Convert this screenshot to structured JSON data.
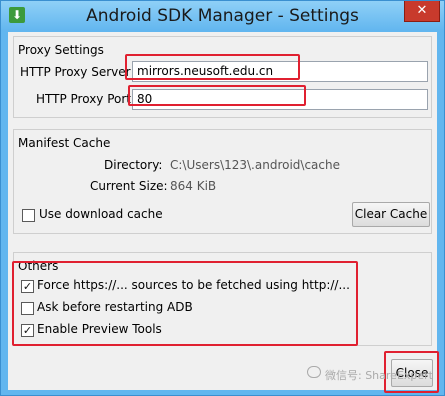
{
  "window": {
    "title": "Android SDK Manager - Settings",
    "app_icon": "download-arrow-icon",
    "close_glyph": "✕"
  },
  "proxy": {
    "group_title": "Proxy Settings",
    "server_label": "HTTP Proxy Server",
    "server_value": "mirrors.neusoft.edu.cn",
    "port_label": "HTTP Proxy Port",
    "port_value": "80"
  },
  "manifest": {
    "group_title": "Manifest Cache",
    "directory_label": "Directory:",
    "directory_value": "C:\\Users\\123\\.android\\cache",
    "size_label": "Current Size:",
    "size_value": "864 KiB",
    "use_cache_label": "Use download cache",
    "use_cache_checked": false,
    "clear_cache_label": "Clear Cache"
  },
  "others": {
    "group_title": "Others",
    "options": [
      {
        "label": "Force https://... sources to be fetched using http://...",
        "checked": true
      },
      {
        "label": "Ask before restarting ADB",
        "checked": false
      },
      {
        "label": "Enable Preview Tools",
        "checked": true
      }
    ]
  },
  "footer": {
    "close_label": "Close",
    "watermark": "微信号: ShareExpert"
  },
  "colors": {
    "highlight": "#e02030",
    "titlebar": "#62b6ef",
    "close_button": "#c83a2c"
  }
}
